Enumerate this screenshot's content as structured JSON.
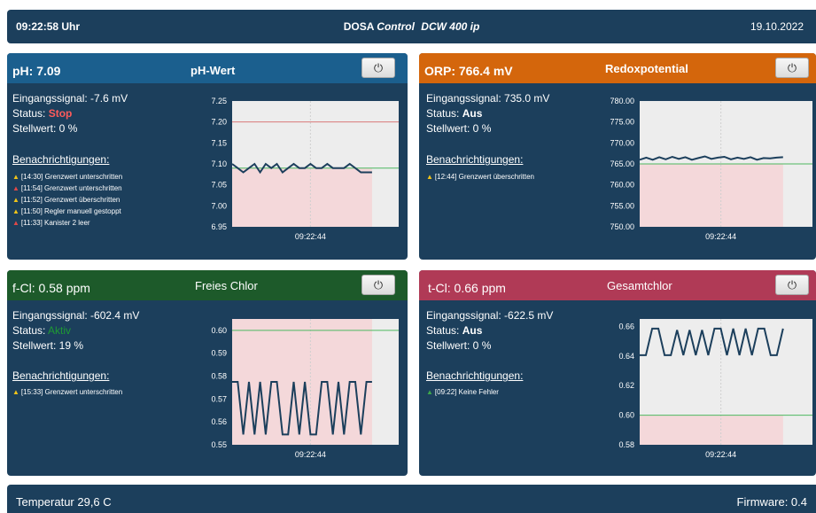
{
  "header": {
    "time": "09:22:58 Uhr",
    "brand": "DOSA",
    "control": "Control",
    "model": "DCW 400 ip",
    "date": "19.10.2022"
  },
  "cards": [
    {
      "id": "ph",
      "reading": "pH: 7.09",
      "title": "pH-Wert",
      "header_color": "#1b5f8e",
      "power_icon": "power-icon",
      "input_signal": "Eingangssignal: -7.6 mV",
      "status_label": "Status:",
      "status_value": "Stop",
      "status_color": "#ff5b5b",
      "output_label": "Stellwert: 0 %",
      "notifications_title": "Benachrichtigungen:",
      "notifications": [
        {
          "level": "warn",
          "text": "[14:30] Grenzwert unterschritten"
        },
        {
          "level": "err",
          "text": "[11:54] Grenzwert unterschritten"
        },
        {
          "level": "warn",
          "text": "[11:52] Grenzwert überschritten"
        },
        {
          "level": "warn",
          "text": "[11:50] Regler manuell gestoppt"
        },
        {
          "level": "err",
          "text": "[11:33] Kanister 2 leer"
        }
      ],
      "chart_time": "09:22:44"
    },
    {
      "id": "orp",
      "reading": "ORP: 766.4 mV",
      "title": "Redoxpotential",
      "header_color": "#d4660c",
      "power_icon": "power-icon",
      "input_signal": "Eingangssignal: 735.0 mV",
      "status_label": "Status:",
      "status_value": "Aus",
      "status_color": "#ffffff",
      "output_label": "Stellwert: 0 %",
      "notifications_title": "Benachrichtigungen:",
      "notifications": [
        {
          "level": "warn",
          "text": "[12:44] Grenzwert überschritten"
        }
      ],
      "chart_time": "09:22:44"
    },
    {
      "id": "fcl",
      "reading": "f-Cl: 0.58 ppm",
      "title": "Freies Chlor",
      "header_color": "#1d5a2a",
      "power_icon": "power-icon",
      "input_signal": "Eingangssignal: -602.4 mV",
      "status_label": "Status:",
      "status_value": "Aktiv",
      "status_color": "#1e9a34",
      "output_label": "Stellwert: 19 %",
      "notifications_title": "Benachrichtigungen:",
      "notifications": [
        {
          "level": "warn",
          "text": "[15:33] Grenzwert unterschritten"
        }
      ],
      "chart_time": "09:22:44"
    },
    {
      "id": "tcl",
      "reading": "t-Cl: 0.66 ppm",
      "title": "Gesamtchlor",
      "header_color": "#b03a56",
      "power_icon": "power-icon",
      "input_signal": "Eingangssignal: -622.5 mV",
      "status_label": "Status:",
      "status_value": "Aus",
      "status_color": "#ffffff",
      "output_label": "Stellwert: 0 %",
      "notifications_title": "Benachrichtigungen:",
      "notifications": [
        {
          "level": "ok",
          "text": "[09:22] Keine Fehler"
        }
      ],
      "chart_time": "09:22:44"
    }
  ],
  "chart_data": [
    {
      "type": "line",
      "card": "ph",
      "yticks": [
        "7.25",
        "7.20",
        "7.15",
        "7.10",
        "7.05",
        "7.00",
        "6.95"
      ],
      "ylim": [
        6.95,
        7.25
      ],
      "x": [
        "09:22:44"
      ],
      "upper_limit": 7.2,
      "lower_limit": 7.09,
      "values": [
        7.1,
        7.09,
        7.08,
        7.09,
        7.1,
        7.08,
        7.1,
        7.09,
        7.1,
        7.08,
        7.09,
        7.1,
        7.09,
        7.09,
        7.1,
        7.09,
        7.09,
        7.1,
        7.09,
        7.09,
        7.09,
        7.1,
        7.09,
        7.08,
        7.08,
        7.08
      ]
    },
    {
      "type": "line",
      "card": "orp",
      "yticks": [
        "780.00",
        "775.00",
        "770.00",
        "765.00",
        "760.00",
        "755.00",
        "750.00"
      ],
      "ylim": [
        750,
        780
      ],
      "x": [
        "09:22:44"
      ],
      "lower_limit": 765,
      "values": [
        766.0,
        766.5,
        766.0,
        766.6,
        766.1,
        766.7,
        766.2,
        766.6,
        766.0,
        766.4,
        766.8,
        766.2,
        766.5,
        766.7,
        766.1,
        766.5,
        766.2,
        766.6,
        766.0,
        766.4,
        766.3,
        766.5,
        766.6
      ]
    },
    {
      "type": "line",
      "card": "fcl",
      "yticks": [
        "0.60",
        "0.59",
        "0.58",
        "0.57",
        "0.56",
        "0.55"
      ],
      "ylim": [
        0.55,
        0.605
      ],
      "x": [
        "09:22:44"
      ],
      "upper_limit": 0.6,
      "values": [
        0.5775,
        0.5775,
        0.5545,
        0.5775,
        0.5545,
        0.5775,
        0.5545,
        0.5775,
        0.5775,
        0.5545,
        0.5545,
        0.5775,
        0.5545,
        0.5775,
        0.5545,
        0.5545,
        0.5775,
        0.5775,
        0.5545,
        0.5775,
        0.5545,
        0.5775,
        0.5775,
        0.5545,
        0.5775,
        0.5775
      ]
    },
    {
      "type": "line",
      "card": "tcl",
      "yticks": [
        "0.66",
        "0.64",
        "0.62",
        "0.60",
        "0.58"
      ],
      "ylim": [
        0.58,
        0.665
      ],
      "x": [
        "09:22:44"
      ],
      "lower_limit": 0.6,
      "values": [
        0.6405,
        0.6405,
        0.6585,
        0.6585,
        0.6405,
        0.6405,
        0.6575,
        0.6405,
        0.6575,
        0.6405,
        0.6575,
        0.6405,
        0.6585,
        0.6585,
        0.6405,
        0.6585,
        0.6405,
        0.6585,
        0.6405,
        0.6585,
        0.6585,
        0.6405,
        0.6405,
        0.6585
      ]
    }
  ],
  "footer": {
    "temperature": "Temperatur 29,6 C",
    "firmware": "Firmware: 0.4"
  }
}
